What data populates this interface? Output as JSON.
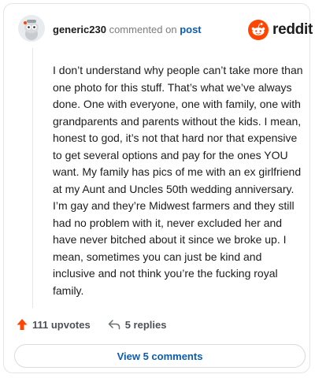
{
  "header": {
    "username": "generic230",
    "action_text": "commented on",
    "post_link": "post",
    "brand": "reddit"
  },
  "comment": {
    "body": "I don’t understand why people can’t take more than one photo for this stuff. That’s what we’ve always done. One with everyone, one with family, one with grandparents and parents without the kids. I mean, honest to god, it’s not that hard nor that expensive to get several options and pay for the ones YOU want. My family has pics of me with an ex girlfriend at my Aunt and Uncles 50th wedding anniversary. I’m gay and they’re Midwest farmers and they still had no problem with it, never excluded her and have never bitched about it since we broke up. I mean, sometimes you can just be kind and inclusive and not think you’re the fucking royal family."
  },
  "actions": {
    "upvotes_label": "111 upvotes",
    "replies_label": "5 replies"
  },
  "footer": {
    "view_comments_label": "View 5 comments"
  },
  "colors": {
    "upvote": "#ff4500",
    "brand": "#ff4500",
    "link": "#0b5cad"
  },
  "icons": {
    "avatar": "snoo-avatar-icon",
    "brand": "reddit-snoo-icon",
    "upvote": "upvote-arrow-icon",
    "reply": "reply-arrow-icon"
  }
}
